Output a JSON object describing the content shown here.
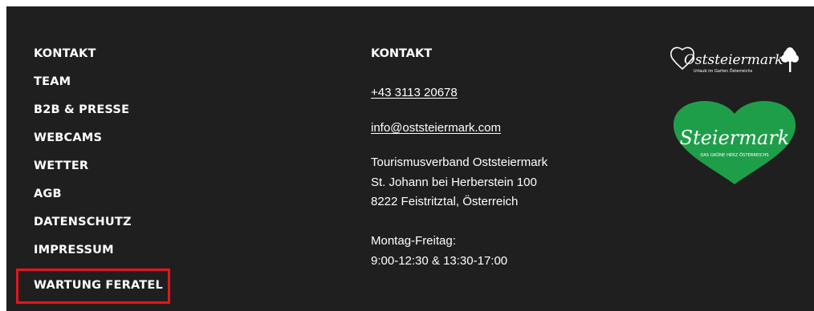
{
  "nav": {
    "items": [
      {
        "label": "KONTAKT"
      },
      {
        "label": "TEAM"
      },
      {
        "label": "B2B & PRESSE"
      },
      {
        "label": "WEBCAMS"
      },
      {
        "label": "WETTER"
      },
      {
        "label": "AGB"
      },
      {
        "label": "DATENSCHUTZ"
      },
      {
        "label": "IMPRESSUM"
      },
      {
        "label": "WARTUNG FERATEL"
      }
    ]
  },
  "contact": {
    "heading": "KONTAKT",
    "phone": "+43 3113 20678",
    "email": "info@oststeiermark.com",
    "address": [
      "Tourismusverband Oststeiermark",
      "St. Johann bei Herberstein 100",
      "8222 Feistritztal, Österreich"
    ],
    "hours": [
      "Montag-Freitag:",
      "9:00-12:30 & 13:30-17:00"
    ]
  },
  "logos": {
    "oststeiermark": {
      "name": "Oststeiermark",
      "tagline": "Urlaub im Garten Österreichs"
    },
    "steiermark": {
      "name": "Steiermark",
      "tagline": "DAS GRÜNE HERZ ÖSTERREICHS"
    }
  },
  "colors": {
    "footer_bg": "#1f1f1f",
    "highlight": "#e8141c",
    "heart_green": "#1f9e49"
  }
}
